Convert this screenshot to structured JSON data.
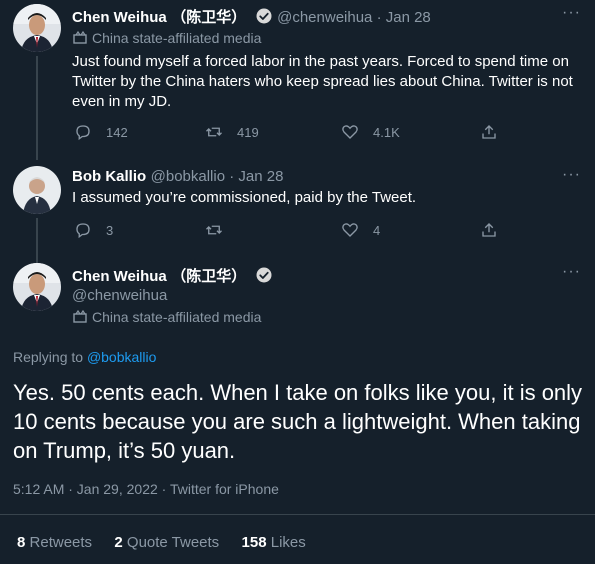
{
  "colors": {
    "background": "#15202b",
    "text": "#ffffff",
    "muted": "#8b98a5",
    "accent": "#1d9bf0",
    "divider": "#38444d"
  },
  "tweet1": {
    "name": "Chen Weihua",
    "name_cn": "（陈卫华）",
    "handle_date": "@chenweihua · Jan 28",
    "affiliation": "China state-affiliated media",
    "text": "Just found myself a forced labor in the past years. Forced to spend time on Twitter by the China haters who keep spread lies about China. Twitter is not even in my JD.",
    "replies": "142",
    "retweets": "419",
    "likes": "4.1K",
    "more": "···"
  },
  "tweet2": {
    "name": "Bob Kallio",
    "handle_date": "@bobkallio · Jan 28",
    "text": "I assumed you’re commissioned, paid by the Tweet.",
    "replies": "3",
    "retweets": "",
    "likes": "4",
    "more": "···"
  },
  "main": {
    "name": "Chen Weihua",
    "name_cn": "（陈卫华）",
    "handle": "@chenweihua",
    "affiliation": "China state-affiliated media",
    "replying_prefix": "Replying to ",
    "replying_to": "@bobkallio",
    "text": "Yes. 50 cents each. When I take on folks like you, it is only 10 cents because you are such a lightweight. When taking on Trump, it’s 50 yuan.",
    "meta": "5:12 AM · Jan 29, 2022 · Twitter for iPhone",
    "more": "···",
    "stats": {
      "retweets_count": "8",
      "retweets_label": "Retweets",
      "quotes_count": "2",
      "quotes_label": "Quote Tweets",
      "likes_count": "158",
      "likes_label": "Likes"
    }
  }
}
